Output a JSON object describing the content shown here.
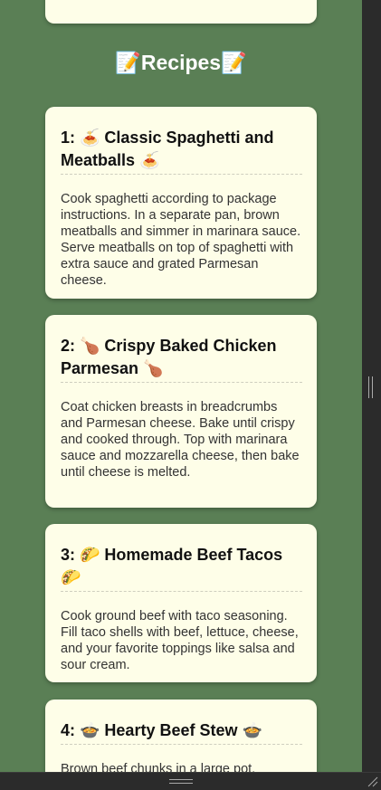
{
  "section": {
    "title": "📝Recipes📝"
  },
  "recipes": [
    {
      "title": "1: 🍝 Classic Spaghetti and Meatballs 🍝",
      "description": "Cook spaghetti according to package instructions. In a separate pan, brown meatballs and simmer in marinara sauce. Serve meatballs on top of spaghetti with extra sauce and grated Parmesan cheese."
    },
    {
      "title": "2: 🍗 Crispy Baked Chicken Parmesan 🍗",
      "description": "Coat chicken breasts in breadcrumbs and Parmesan cheese. Bake until crispy and cooked through. Top with marinara sauce and mozzarella cheese, then bake until cheese is melted."
    },
    {
      "title": "3: 🌮 Homemade Beef Tacos 🌮",
      "description": "Cook ground beef with taco seasoning. Fill taco shells with beef, lettuce, cheese, and your favorite toppings like salsa and sour cream."
    },
    {
      "title": "4: 🍲 Hearty Beef Stew 🍲",
      "description": "Brown beef chunks in a large pot."
    }
  ],
  "colors": {
    "page_background": "#5a7f55",
    "card_background": "#fefee8",
    "scrollbar": "#2b2b2b"
  }
}
